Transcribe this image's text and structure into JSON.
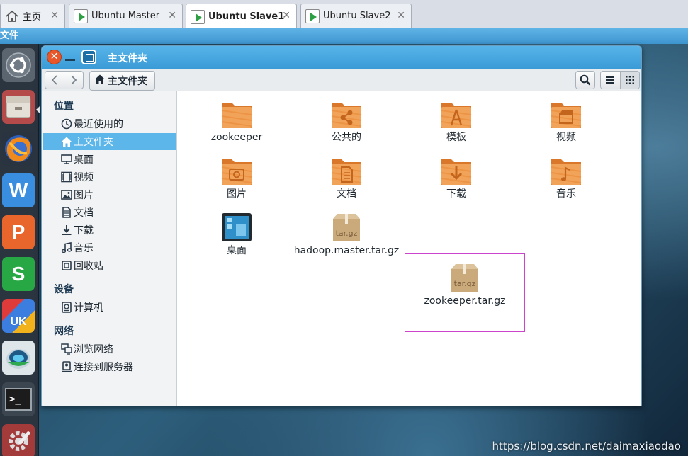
{
  "host": {
    "tabs": [
      {
        "label": "主页",
        "active": false
      },
      {
        "label": "Ubuntu Master",
        "active": false
      },
      {
        "label": "Ubuntu Slave1",
        "active": true
      },
      {
        "label": "Ubuntu Slave2",
        "active": false
      }
    ],
    "menu_label": "文件",
    "watermark": "https://blog.csdn.net/daimaxiaodao"
  },
  "launcher": {
    "items": [
      {
        "name": "ubuntu-dash-icon"
      },
      {
        "name": "file-manager-icon"
      },
      {
        "name": "firefox-icon"
      },
      {
        "name": "wps-writer-icon",
        "glyph": "W"
      },
      {
        "name": "wps-presentation-icon",
        "glyph": "P"
      },
      {
        "name": "wps-spreadsheet-icon",
        "glyph": "S"
      },
      {
        "name": "ubuntu-kylin-software-icon",
        "glyph": "UK"
      },
      {
        "name": "kylin-assistant-icon"
      },
      {
        "name": "terminal-icon",
        "glyph": ">_"
      },
      {
        "name": "system-settings-icon"
      }
    ]
  },
  "window": {
    "title": "主文件夹",
    "breadcrumb": "主文件夹",
    "sidebar": {
      "sections": [
        {
          "heading": "位置",
          "items": [
            {
              "label": "最近使用的",
              "icon": "clock-icon",
              "selected": false
            },
            {
              "label": "主文件夹",
              "icon": "home-icon",
              "selected": true
            },
            {
              "label": "桌面",
              "icon": "desktop-icon",
              "selected": false
            },
            {
              "label": "视频",
              "icon": "video-icon",
              "selected": false
            },
            {
              "label": "图片",
              "icon": "image-icon",
              "selected": false
            },
            {
              "label": "文档",
              "icon": "document-icon",
              "selected": false
            },
            {
              "label": "下载",
              "icon": "download-icon",
              "selected": false
            },
            {
              "label": "音乐",
              "icon": "music-icon",
              "selected": false
            },
            {
              "label": "回收站",
              "icon": "trash-icon",
              "selected": false
            }
          ]
        },
        {
          "heading": "设备",
          "items": [
            {
              "label": "计算机",
              "icon": "drive-icon",
              "selected": false
            }
          ]
        },
        {
          "heading": "网络",
          "items": [
            {
              "label": "浏览网络",
              "icon": "network-icon",
              "selected": false
            },
            {
              "label": "连接到服务器",
              "icon": "server-icon",
              "selected": false
            }
          ]
        }
      ]
    },
    "files": [
      {
        "label": "zookeeper",
        "type": "folder"
      },
      {
        "label": "公共的",
        "type": "folder-share"
      },
      {
        "label": "模板",
        "type": "folder-template"
      },
      {
        "label": "视频",
        "type": "folder-video"
      },
      {
        "label": "图片",
        "type": "folder-pictures"
      },
      {
        "label": "文档",
        "type": "folder-documents"
      },
      {
        "label": "下载",
        "type": "folder-download"
      },
      {
        "label": "音乐",
        "type": "folder-music"
      },
      {
        "label": "桌面",
        "type": "desktop"
      },
      {
        "label": "hadoop.master.tar.gz",
        "type": "archive",
        "icon_text": "tar.gz"
      },
      {
        "label": "zookeeper.tar.gz",
        "type": "archive",
        "icon_text": "tar.gz",
        "highlighted": true
      }
    ]
  },
  "colors": {
    "accent": "#5cb6ea",
    "titlebar": "#3b9bd6",
    "folder": "#e8913a",
    "archive": "#c9a87a",
    "highlight_box": "#cc44cc"
  }
}
